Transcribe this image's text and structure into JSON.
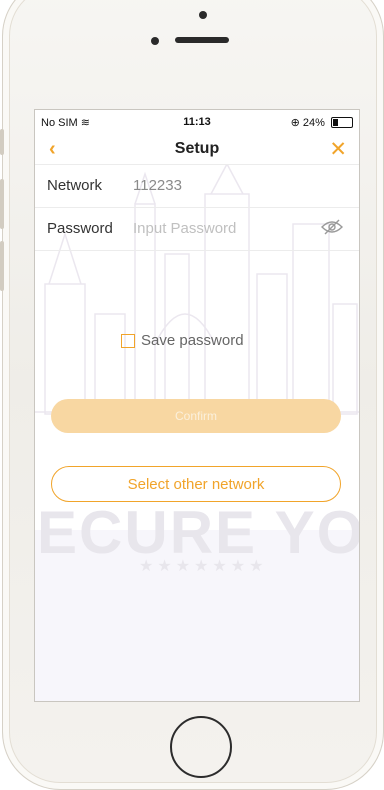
{
  "status_bar": {
    "carrier": "No SIM",
    "time": "11:13",
    "battery_text": "24%"
  },
  "nav": {
    "title": "Setup",
    "back_icon": "chevron-left-icon",
    "close_icon": "close-icon"
  },
  "form": {
    "network_label": "Network",
    "network_value": "112233",
    "password_label": "Password",
    "password_placeholder": "Input Password"
  },
  "save_password_label": "Save password",
  "confirm_button_label": "Confirm",
  "other_network_label": "Select other network",
  "watermark_text": "SECURE YOU",
  "colors": {
    "accent": "#f1a42a",
    "confirm_bg": "#f8d7a2",
    "watermark": "#e8e6ec"
  }
}
